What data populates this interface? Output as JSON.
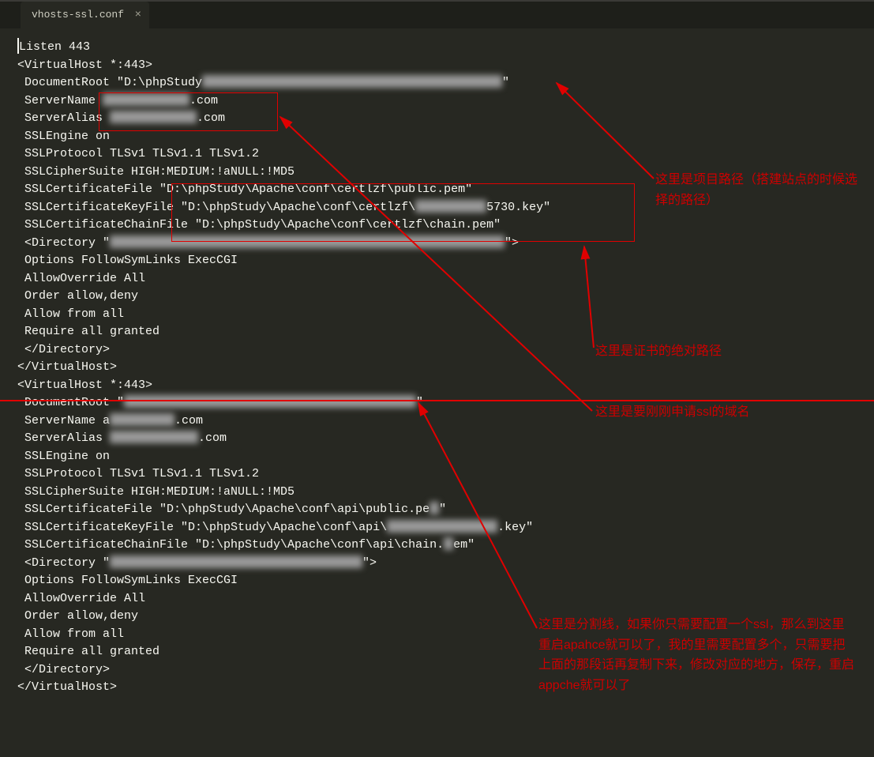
{
  "tab": {
    "filename": "vhosts-ssl.conf",
    "active": true
  },
  "code": {
    "l1": "Listen 443",
    "l2": "<VirtualHost *:443>",
    "l3a": " DocumentRoot \"D:\\phpStudy",
    "l3b": "\"",
    "l4a": " ServerName ",
    "l4b": ".com",
    "l5a": " ServerAlias ",
    "l5b": ".com",
    "l6": " SSLEngine on",
    "l7": " SSLProtocol TLSv1 TLSv1.1 TLSv1.2",
    "l8": " SSLCipherSuite HIGH:MEDIUM:!aNULL:!MD5",
    "l9": " SSLCertificateFile \"D:\\phpStudy\\Apache\\conf\\certlzf\\public.pem\"",
    "l10a": " SSLCertificateKeyFile \"D:\\phpStudy\\Apache\\conf\\certlzf\\",
    "l10b": "5730.key\"",
    "l11": " SSLCertificateChainFile \"D:\\phpStudy\\Apache\\conf\\certlzf\\chain.pem\"",
    "l12": "",
    "l13a": " <Directory \"",
    "l13b": "\">",
    "l14": " Options FollowSymLinks ExecCGI",
    "l15": " AllowOverride All",
    "l16": " Order allow,deny",
    "l17": " Allow from all",
    "l18": " Require all granted",
    "l19": " </Directory>",
    "l20": "</VirtualHost>",
    "l21": "",
    "l22": "<VirtualHost *:443>",
    "l23a": " DocumentRoot \"",
    "l23b": "\"",
    "l24a": " ServerName a",
    "l24b": ".com",
    "l25a": " ServerAlias ",
    "l25b": ".com",
    "l26": " SSLEngine on",
    "l27": " SSLProtocol TLSv1 TLSv1.1 TLSv1.2",
    "l28": " SSLCipherSuite HIGH:MEDIUM:!aNULL:!MD5",
    "l29a": " SSLCertificateFile \"D:\\phpStudy\\Apache\\conf\\api\\public.pe",
    "l29b": "\"",
    "l30a": " SSLCertificateKeyFile \"D:\\phpStudy\\Apache\\conf\\api\\",
    "l30b": ".key\"",
    "l31a": " SSLCertificateChainFile \"D:\\phpStudy\\Apache\\conf\\api\\chain.",
    "l31b": "em\"",
    "l32": "",
    "l33a": " <Directory \"",
    "l33b": "\">",
    "l34": " Options FollowSymLinks ExecCGI",
    "l35": " AllowOverride All",
    "l36": " Order allow,deny",
    "l37": " Allow from all",
    "l38": " Require all granted",
    "l39": " </Directory>",
    "l40": "</VirtualHost>"
  },
  "annotations": {
    "proj_path": "这里是项目路径（搭建站点的时候选择的路径）",
    "cert_path": "这里是证书的绝对路径",
    "ssl_domain": "这里是要刚刚申请ssl的域名",
    "separator": "这里是分割线，如果你只需要配置一个ssl，那么到这里重启apahce就可以了，我的里需要配置多个，只需要把上面的那段话再复制下来，修改对应的地方，保存，重启appche就可以了"
  }
}
